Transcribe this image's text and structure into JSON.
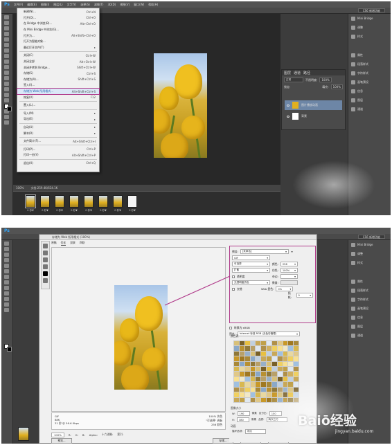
{
  "app": {
    "logo": "Ps"
  },
  "menubar": [
    "文件(F)",
    "编辑(E)",
    "图像(I)",
    "图层(L)",
    "文字(Y)",
    "选择(S)",
    "滤镜(T)",
    "3D(D)",
    "视图(V)",
    "窗口(W)",
    "帮助(H)"
  ],
  "file_menu": {
    "items": [
      {
        "label": "新建(N)...",
        "shortcut": "Ctrl+N"
      },
      {
        "label": "打开(O)...",
        "shortcut": "Ctrl+O"
      },
      {
        "label": "在 Bridge 中浏览(B)...",
        "shortcut": "Alt+Ctrl+O"
      },
      {
        "label": "在 Mini Bridge 中浏览(G)...",
        "shortcut": ""
      },
      {
        "label": "打开为...",
        "shortcut": "Alt+Shift+Ctrl+O"
      },
      {
        "label": "打开为智能对象...",
        "shortcut": ""
      },
      {
        "label": "最近打开文件(T)",
        "shortcut": "",
        "submenu": true
      },
      {
        "sep": true
      },
      {
        "label": "关闭(C)",
        "shortcut": "Ctrl+W"
      },
      {
        "label": "关闭全部",
        "shortcut": "Alt+Ctrl+W"
      },
      {
        "label": "关闭并转到 Bridge...",
        "shortcut": "Shift+Ctrl+W"
      },
      {
        "label": "存储(S)",
        "shortcut": "Ctrl+S"
      },
      {
        "label": "存储为(A)...",
        "shortcut": "Shift+Ctrl+S"
      },
      {
        "label": "签入(I)...",
        "shortcut": ""
      },
      {
        "label": "存储为 Web 所用格式...",
        "shortcut": "Alt+Shift+Ctrl+S",
        "highlight": true
      },
      {
        "label": "恢复(V)",
        "shortcut": "F12"
      },
      {
        "sep": true
      },
      {
        "label": "置入(L)...",
        "shortcut": ""
      },
      {
        "sep": true
      },
      {
        "label": "导入(M)",
        "shortcut": "",
        "submenu": true
      },
      {
        "label": "导出(E)",
        "shortcut": "",
        "submenu": true
      },
      {
        "sep": true
      },
      {
        "label": "自动(U)",
        "shortcut": "",
        "submenu": true
      },
      {
        "label": "脚本(R)",
        "shortcut": "",
        "submenu": true
      },
      {
        "sep": true
      },
      {
        "label": "文件简介(F)...",
        "shortcut": "Alt+Shift+Ctrl+I"
      },
      {
        "sep": true
      },
      {
        "label": "打印(P)...",
        "shortcut": "Ctrl+P"
      },
      {
        "label": "打印一份(Y)",
        "shortcut": "Alt+Shift+Ctrl+P"
      },
      {
        "sep": true
      },
      {
        "label": "退出(X)",
        "shortcut": "Ctrl+Q"
      }
    ]
  },
  "right_panel": {
    "items": [
      {
        "label": "Mini Bridge",
        "icon": "bridge-icon"
      },
      {
        "label": "调整",
        "icon": "adjust-icon"
      },
      {
        "label": "样式",
        "icon": "style-icon"
      },
      {
        "label": "属性",
        "icon": "properties-icon"
      },
      {
        "label": "段落样式",
        "icon": "paragraph-style-icon"
      },
      {
        "label": "字符样式",
        "icon": "character-style-icon"
      },
      {
        "label": "画笔预设",
        "icon": "brush-preset-icon"
      },
      {
        "label": "信息",
        "icon": "info-icon"
      },
      {
        "label": "图层",
        "icon": "layers-icon"
      },
      {
        "label": "通道",
        "icon": "channels-icon"
      }
    ],
    "workspace": "CS6 新增功能"
  },
  "layers_panel": {
    "tabs": [
      "图层",
      "通道",
      "路径"
    ],
    "blend": "正常",
    "opacity_label": "不透明度:",
    "opacity": "100%",
    "lock_label": "锁定:",
    "fill_label": "填充:",
    "fill": "100%",
    "rows": [
      {
        "name": "图片播放动画"
      },
      {
        "name": "背景"
      }
    ]
  },
  "status1": {
    "zoom": "100%",
    "doc": "文档:259.4K/634.1K"
  },
  "frames": [
    {
      "label": "0 秒▼"
    },
    {
      "label": "0 秒▼"
    },
    {
      "label": "0 秒▼"
    },
    {
      "label": "0 秒▼"
    },
    {
      "label": "0 秒▼"
    },
    {
      "label": "0 秒▼"
    },
    {
      "label": "0 秒▼"
    },
    {
      "label": "0 秒▼"
    },
    {
      "label": "0 秒▼"
    }
  ],
  "dialog": {
    "title": "存储为 Web 所用格式 (100%)",
    "tabs": [
      "原稿",
      "优化",
      "双联",
      "四联"
    ],
    "settings": {
      "preset_label": "预设:",
      "preset": "[未命名]",
      "format": "GIF",
      "reduction": "可选择",
      "colors_label": "颜色:",
      "colors": "256",
      "dither_algo": "扩散",
      "dither_label": "仿色:",
      "dither": "100%",
      "transparency_label": "透明度",
      "matte_label": "杂边:",
      "trans_dither": "无透明度仿色",
      "amount_label": "数量:",
      "interlaced_label": "交错",
      "web_snap_label": "Web 靠色:",
      "web_snap": "0%",
      "lossy_label": "损耗:",
      "lossy": "0"
    },
    "lower": {
      "convert_label": "转换为 sRGB",
      "preview_label": "预览:",
      "preview": "Internet 标准 RGB (无色彩管理)",
      "metadata_label": "元数据:",
      "metadata": "无",
      "color_table_label": "颜色表",
      "image_size_label": "图像大小",
      "w_label": "W:",
      "w_val": "190",
      "h_label": "H:",
      "h_val": "380",
      "px": "像素",
      "percent_label": "百分比:",
      "percent": "100",
      "quality_label": "品质:",
      "quality": "两次立方",
      "anim_label": "动画",
      "loop_label": "循环选项:",
      "loop": "永远"
    },
    "info": {
      "format": "GIF",
      "size": "88K",
      "time": "31 秒 @ 56.6 Kbps",
      "r1": "100% 仿色",
      "r2": "\"可选择\" 调板",
      "r3": "256 颜色"
    },
    "bottom": {
      "zoom": "100%",
      "r": "R:",
      "g": "G:",
      "b": "B:",
      "alpha": "Alpha:",
      "hex": "十六进制:",
      "index": "索引:"
    },
    "buttons": {
      "preview": "预览...",
      "save": "存储...",
      "cancel": "取消",
      "done": "完成"
    }
  },
  "watermark": {
    "brand": "Baiō经验",
    "url": "jingyan.baidu.com"
  },
  "colors": {
    "highlight": "#b03a8a",
    "ps_bg": "#3c3c3c",
    "ps_panel": "#4a4a4a",
    "ps_blue": "#31a8ff"
  }
}
